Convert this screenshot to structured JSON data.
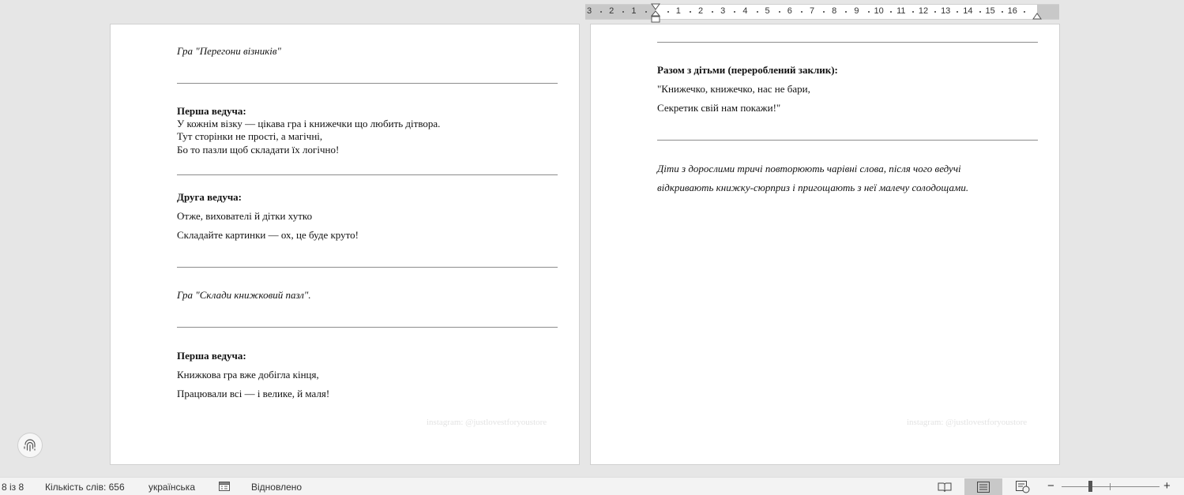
{
  "ruler": {
    "labels": [
      "3",
      "2",
      "1",
      "",
      "1",
      "2",
      "3",
      "4",
      "5",
      "6",
      "7",
      "8",
      "9",
      "10",
      "11",
      "12",
      "13",
      "14",
      "15",
      "16"
    ]
  },
  "left_page": {
    "game1": "Гра \"Перегони візників\"",
    "block1": {
      "speaker": "Перша ведуча:",
      "lines": [
        "У кожнім візку — цікава гра і книжечки що любить дітвора.",
        "Тут сторінки не прості, а магічні,",
        "Бо то пазли щоб складати їх логічно!"
      ]
    },
    "block2": {
      "speaker": "Друга ведуча:",
      "lines": [
        "Отже, вихователі й дітки хутко",
        "Складайте картинки — ох, це буде круто!"
      ]
    },
    "game2": "Гра \"Склади книжковий пазл\".",
    "block3": {
      "speaker": "Перша ведуча:",
      "lines": [
        "Книжкова гра вже добігла кінця,",
        "Працювали всі — і велике, й маля!"
      ]
    },
    "watermark": "instagram: @justlovestforyoustore"
  },
  "right_page": {
    "block1": {
      "speaker": "Разом з дітьми (перероблений заклик):",
      "lines": [
        "\"Книжечко, книжечко, нас не бари,",
        "Секретик свій нам покажи!\""
      ]
    },
    "closing": [
      "Діти з дорослими тричі повторюють чарівні слова, після чого ведучі",
      "відкривають книжку-сюрприз і пригощають з неї малечу солодощами."
    ],
    "watermark": "instagram: @justlovestforyoustore"
  },
  "status_bar": {
    "page": "8 із 8",
    "word_count": "Кількість слів: 656",
    "language": "українська",
    "restored": "Відновлено",
    "zoom_minus": "−",
    "zoom_plus": "+"
  }
}
